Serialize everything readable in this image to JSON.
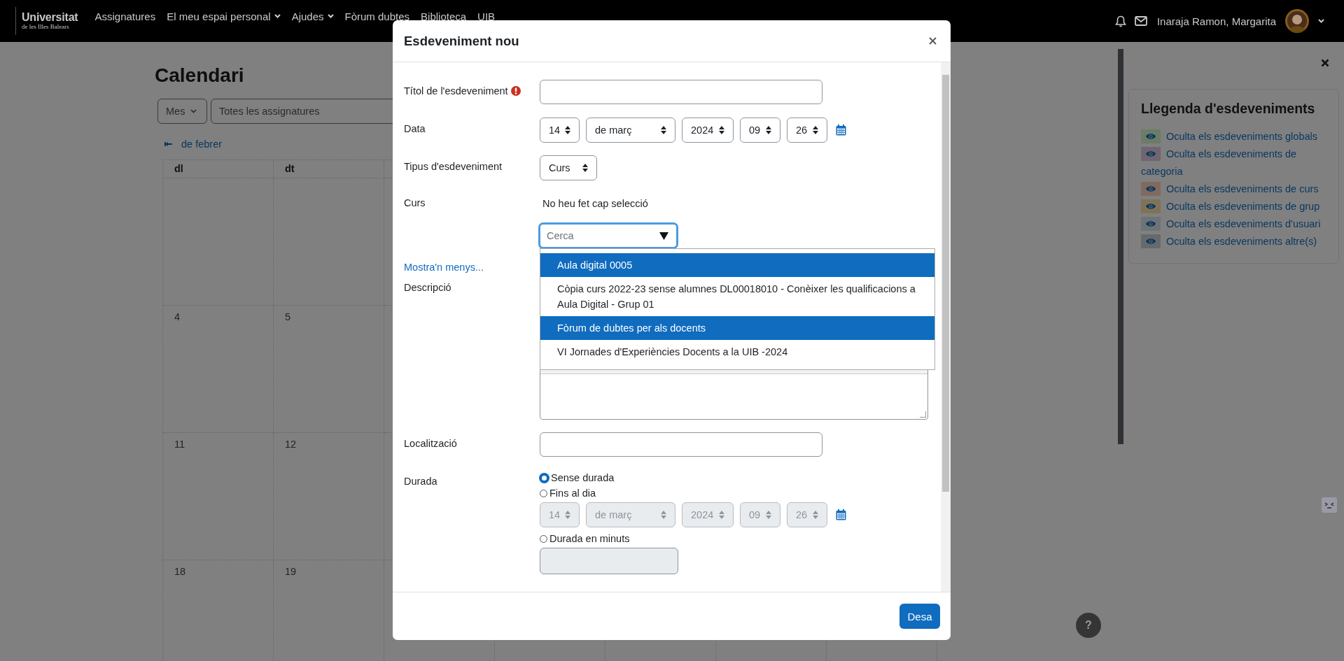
{
  "navbar": {
    "logo": {
      "name": "Universitat",
      "subtitle": "de les Illes Balears"
    },
    "items": [
      {
        "label": "Assignatures",
        "dropdown": false
      },
      {
        "label": "El meu espai personal",
        "dropdown": true
      },
      {
        "label": "Ajudes",
        "dropdown": true
      },
      {
        "label": "Fòrum dubtes",
        "dropdown": false
      },
      {
        "label": "Biblioteca",
        "dropdown": false
      },
      {
        "label": "UIB",
        "dropdown": false
      }
    ],
    "user_name": "Inaraja Ramon, Margarita"
  },
  "calendar": {
    "title": "Calendari",
    "view_select": "Mes",
    "course_select": "Totes les assignatures",
    "prev_month": "de febrer",
    "weekdays": [
      "dl",
      "dt"
    ],
    "weeks": [
      {
        "days": [
          "4",
          "5"
        ]
      },
      {
        "days": [
          "11",
          "12"
        ]
      },
      {
        "days": [
          "18",
          "19"
        ]
      }
    ]
  },
  "legend": {
    "title": "Llegenda d'esdeveniments",
    "items": [
      {
        "label": "Oculta els esdeveniments globals",
        "color": "#6b7c67"
      },
      {
        "label": "Oculta els esdeveniments de categoria",
        "color": "#706570"
      },
      {
        "label": "Oculta els esdeveniments de curs",
        "color": "#806a5f"
      },
      {
        "label": "Oculta els esdeveniments de grup",
        "color": "#7f7357"
      },
      {
        "label": "Oculta els esdeveniments d'usuari",
        "color": "#6e7476"
      },
      {
        "label": "Oculta els esdeveniments altre(s)",
        "color": "#676a6d"
      }
    ]
  },
  "help_button": "?",
  "modal": {
    "title": "Esdeveniment nou",
    "name_field": {
      "label": "Títol de l'esdeveniment",
      "required": true
    },
    "date": {
      "label": "Data",
      "day": "14",
      "month": "de març",
      "year": "2024",
      "hour": "09",
      "minute": "26"
    },
    "event_type": {
      "label": "Tipus d'esdeveniment",
      "value": "Curs"
    },
    "course": {
      "label": "Curs",
      "selection": "No heu fet cap selecció",
      "search_placeholder": "Cerca",
      "options": [
        {
          "label": "Aula digital 0005",
          "highlighted": true
        },
        {
          "label": "Còpia curs 2022-23 sense alumnes DL00018010 - Conèixer les qualificacions a Aula Digital - Grup 01",
          "highlighted": false
        },
        {
          "label": "Fòrum de dubtes per als docents",
          "highlighted": true
        },
        {
          "label": "VI Jornades d'Experiències Docents a la UIB -2024",
          "highlighted": false
        }
      ]
    },
    "show_less": "Mostra'n menys...",
    "description": {
      "label": "Descripció"
    },
    "location": {
      "label": "Localització"
    },
    "duration": {
      "label": "Durada",
      "options": [
        {
          "label": "Sense durada",
          "selected": true
        },
        {
          "label": "Fins al dia",
          "selected": false
        },
        {
          "label": "Durada en minuts",
          "selected": false
        }
      ],
      "until": {
        "day": "14",
        "month": "de març",
        "year": "2024",
        "hour": "09",
        "minute": "26",
        "disabled": true
      },
      "minutes": {
        "disabled": true
      }
    },
    "save_button": "Desa"
  }
}
